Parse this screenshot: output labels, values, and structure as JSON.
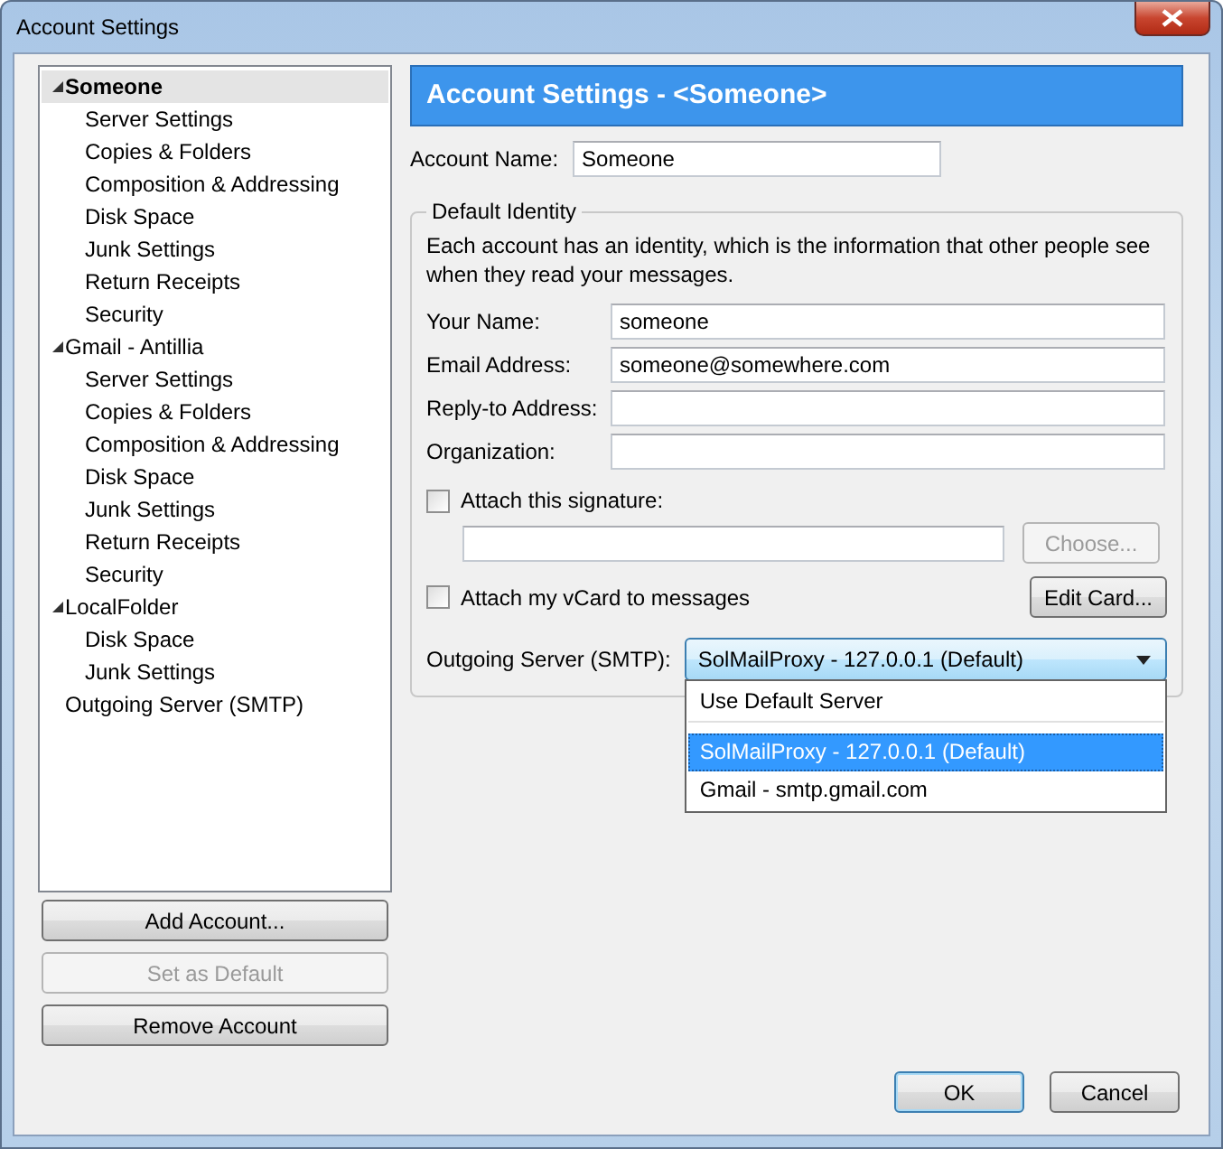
{
  "window": {
    "title": "Account Settings"
  },
  "sidebar": {
    "items": [
      {
        "label": "Someone",
        "selected": true,
        "expanded": true,
        "children": [
          {
            "label": "Server Settings",
            "selected": false
          },
          {
            "label": "Copies & Folders",
            "selected": false
          },
          {
            "label": "Composition & Addressing",
            "selected": false
          },
          {
            "label": "Disk Space",
            "selected": false
          },
          {
            "label": "Junk Settings",
            "selected": false
          },
          {
            "label": "Return Receipts",
            "selected": false
          },
          {
            "label": "Security",
            "selected": false
          }
        ]
      },
      {
        "label": "Gmail - Antillia",
        "selected": false,
        "expanded": true,
        "children": [
          {
            "label": "Server Settings",
            "selected": false
          },
          {
            "label": "Copies & Folders",
            "selected": false
          },
          {
            "label": "Composition & Addressing",
            "selected": false
          },
          {
            "label": "Disk Space",
            "selected": false
          },
          {
            "label": "Junk Settings",
            "selected": false
          },
          {
            "label": "Return Receipts",
            "selected": false
          },
          {
            "label": "Security",
            "selected": false
          }
        ]
      },
      {
        "label": "LocalFolder",
        "selected": false,
        "expanded": true,
        "children": [
          {
            "label": "Disk Space",
            "selected": false
          },
          {
            "label": "Junk Settings",
            "selected": false
          }
        ]
      },
      {
        "label": "Outgoing Server (SMTP)",
        "selected": false,
        "expanded": false
      }
    ],
    "buttons": [
      {
        "label": "Add Account...",
        "disabled": false
      },
      {
        "label": "Set as Default",
        "disabled": true
      },
      {
        "label": "Remove Account",
        "disabled": false
      }
    ]
  },
  "panel": {
    "header": "Account Settings - <Someone>",
    "account_name": {
      "label": "Account Name:",
      "value": "Someone"
    },
    "identity": {
      "legend": "Default Identity",
      "description": "Each account has an identity, which is the information that other people see when they read your messages.",
      "fields": [
        {
          "label": "Your Name:",
          "value": "someone"
        },
        {
          "label": "Email Address:",
          "value": "someone@somewhere.com"
        },
        {
          "label": "Reply-to Address:"
        },
        {
          "label": "Organization:"
        }
      ],
      "signature": {
        "label": "Attach this signature:",
        "checked": false,
        "button": {
          "label": "Choose...",
          "disabled": true
        }
      },
      "vcard": {
        "label": "Attach my vCard to messages",
        "checked": false,
        "button": {
          "label": "Edit Card...",
          "disabled": false
        }
      },
      "outgoing": {
        "label": "Outgoing Server (SMTP):",
        "value": "SolMailProxy - 127.0.0.1 (Default)",
        "expanded": true,
        "options": [
          {
            "label": "Use Default Server",
            "selected": false
          },
          {
            "label": "SolMailProxy - 127.0.0.1 (Default)",
            "selected": true
          },
          {
            "label": "Gmail - smtp.gmail.com",
            "selected": false
          }
        ]
      }
    }
  },
  "footer": {
    "buttons": [
      {
        "label": "OK",
        "default": true
      },
      {
        "label": "Cancel",
        "default": false
      }
    ]
  }
}
